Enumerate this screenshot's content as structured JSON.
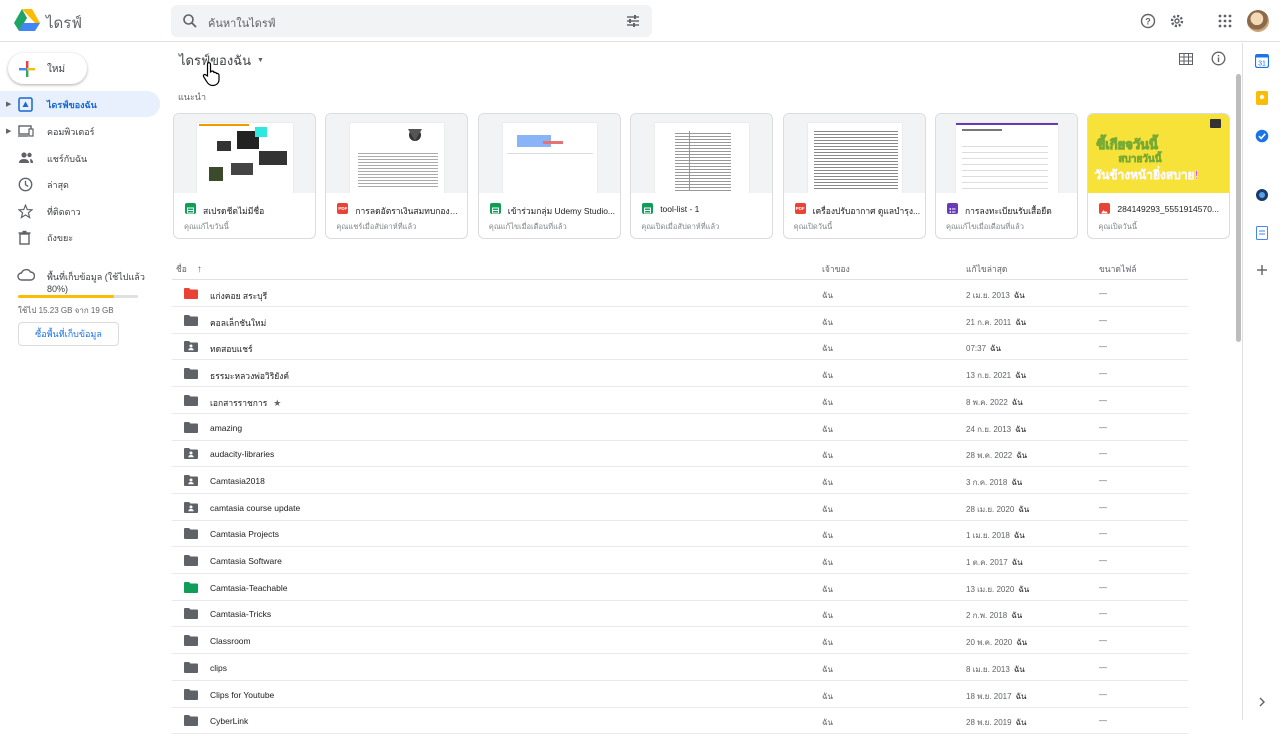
{
  "app": {
    "title": "ไดรฟ์"
  },
  "search": {
    "placeholder": "ค้นหาในไดรฟ์"
  },
  "sidebar": {
    "new_label": "ใหม่",
    "items": [
      {
        "label": "ไดรฟ์ของฉัน",
        "icon": "my-drive-icon",
        "active": true,
        "caret": true
      },
      {
        "label": "คอมพิวเตอร์",
        "icon": "computer-icon",
        "active": false,
        "caret": true
      },
      {
        "label": "แชร์กับฉัน",
        "icon": "shared-icon",
        "active": false,
        "caret": false
      },
      {
        "label": "ล่าสุด",
        "icon": "clock-icon",
        "active": false,
        "caret": false
      },
      {
        "label": "ที่ติดดาว",
        "icon": "star-icon",
        "active": false,
        "caret": false
      },
      {
        "label": "ถังขยะ",
        "icon": "trash-icon",
        "active": false,
        "caret": false
      }
    ],
    "storage": {
      "label": "พื้นที่เก็บข้อมูล (ใช้ไปแล้ว 80%)",
      "used_percent": 80,
      "usage_text": "ใช้ไป 15.23 GB จาก 19 GB",
      "buy_label": "ซื้อพื้นที่เก็บข้อมูล"
    }
  },
  "main": {
    "breadcrumb": "ไดรฟ์ของฉัน",
    "suggested_title": "แนะนำ",
    "cards": [
      {
        "name": "สเปรดชีตไม่มีชื่อ",
        "meta": "คุณแก้ไขวันนี้",
        "type": "sheet"
      },
      {
        "name": "การลดอัตราเงินสมทบกองทุน...",
        "meta": "คุณแชร์เมื่อสัปดาห์ที่แล้ว",
        "type": "pdf"
      },
      {
        "name": "เข้าร่วมกลุ่ม Udemy Studio...",
        "meta": "คุณแก้ไขเมื่อเดือนที่แล้ว",
        "type": "sheet"
      },
      {
        "name": "tool-list - 1",
        "meta": "คุณเปิดเมื่อสัปดาห์ที่แล้ว",
        "type": "sheet"
      },
      {
        "name": "เครื่องปรับอากาศ ดูแลบำรุง...",
        "meta": "คุณเปิดวันนี้",
        "type": "pdf"
      },
      {
        "name": "การลงทะเบียนรับเสื้อยืด",
        "meta": "คุณแก้ไขเมื่อเดือนที่แล้ว",
        "type": "form"
      },
      {
        "name": "284149293_5551914570...",
        "meta": "คุณเปิดวันนี้",
        "type": "image",
        "poster_line1": "ขี้เกียจวันนี้",
        "poster_line2": "สบายวันนี้",
        "poster_line3": "วันข้างหน้ายิ่งสบาย!"
      }
    ],
    "columns": {
      "name": "ชื่อ",
      "owner": "เจ้าของ",
      "modified": "แก้ไขล่าสุด",
      "size": "ขนาดไฟล์"
    },
    "files": [
      {
        "name": "แก่งคอย สระบุรี",
        "owner": "ฉัน",
        "date": "2 เม.ย. 2013",
        "by": "ฉัน",
        "size": "—",
        "color": "#ea4335",
        "shared": false,
        "starred": false
      },
      {
        "name": "คอลเล็กชันใหม่",
        "owner": "ฉัน",
        "date": "21 ก.ค. 2011",
        "by": "ฉัน",
        "size": "—",
        "color": "#5f6368",
        "shared": false,
        "starred": false
      },
      {
        "name": "ทดสอบแชร์",
        "owner": "ฉัน",
        "date": "07:37",
        "by": "ฉัน",
        "size": "—",
        "color": "#5f6368",
        "shared": true,
        "starred": false
      },
      {
        "name": "ธรรมะหลวงพ่อวิริยังค์",
        "owner": "ฉัน",
        "date": "13 ก.ย. 2021",
        "by": "ฉัน",
        "size": "—",
        "color": "#5f6368",
        "shared": false,
        "starred": false
      },
      {
        "name": "เอกสารราชการ",
        "owner": "ฉัน",
        "date": "8 พ.ค. 2022",
        "by": "ฉัน",
        "size": "—",
        "color": "#5f6368",
        "shared": false,
        "starred": true
      },
      {
        "name": "amazing",
        "owner": "ฉัน",
        "date": "24 ก.ย. 2013",
        "by": "ฉัน",
        "size": "—",
        "color": "#5f6368",
        "shared": false,
        "starred": false
      },
      {
        "name": "audacity-libraries",
        "owner": "ฉัน",
        "date": "28 พ.ค. 2022",
        "by": "ฉัน",
        "size": "—",
        "color": "#5f6368",
        "shared": true,
        "starred": false
      },
      {
        "name": "Camtasia2018",
        "owner": "ฉัน",
        "date": "3 ก.ค. 2018",
        "by": "ฉัน",
        "size": "—",
        "color": "#5f6368",
        "shared": true,
        "starred": false
      },
      {
        "name": "camtasia course update",
        "owner": "ฉัน",
        "date": "28 เม.ย. 2020",
        "by": "ฉัน",
        "size": "—",
        "color": "#5f6368",
        "shared": true,
        "starred": false
      },
      {
        "name": "Camtasia Projects",
        "owner": "ฉัน",
        "date": "1 เม.ย. 2018",
        "by": "ฉัน",
        "size": "—",
        "color": "#5f6368",
        "shared": false,
        "starred": false
      },
      {
        "name": "Camtasia Software",
        "owner": "ฉัน",
        "date": "1 ต.ค. 2017",
        "by": "ฉัน",
        "size": "—",
        "color": "#5f6368",
        "shared": false,
        "starred": false
      },
      {
        "name": "Camtasia-Teachable",
        "owner": "ฉัน",
        "date": "13 เม.ย. 2020",
        "by": "ฉัน",
        "size": "—",
        "color": "#0f9d58",
        "shared": false,
        "starred": false
      },
      {
        "name": "Camtasia-Tricks",
        "owner": "ฉัน",
        "date": "2 ก.พ. 2018",
        "by": "ฉัน",
        "size": "—",
        "color": "#5f6368",
        "shared": false,
        "starred": false
      },
      {
        "name": "Classroom",
        "owner": "ฉัน",
        "date": "20 พ.ค. 2020",
        "by": "ฉัน",
        "size": "—",
        "color": "#5f6368",
        "shared": false,
        "starred": false
      },
      {
        "name": "clips",
        "owner": "ฉัน",
        "date": "8 เม.ย. 2013",
        "by": "ฉัน",
        "size": "—",
        "color": "#5f6368",
        "shared": false,
        "starred": false
      },
      {
        "name": "Clips for Youtube",
        "owner": "ฉัน",
        "date": "18 พ.ย. 2017",
        "by": "ฉัน",
        "size": "—",
        "color": "#5f6368",
        "shared": false,
        "starred": false
      },
      {
        "name": "CyberLink",
        "owner": "ฉัน",
        "date": "28 พ.ย. 2019",
        "by": "ฉัน",
        "size": "—",
        "color": "#5f6368",
        "shared": false,
        "starred": false
      }
    ]
  },
  "colors": {
    "accent": "#1a73e8",
    "active_bg": "#e8f0fe",
    "storage_fill": "#fbbc04"
  }
}
